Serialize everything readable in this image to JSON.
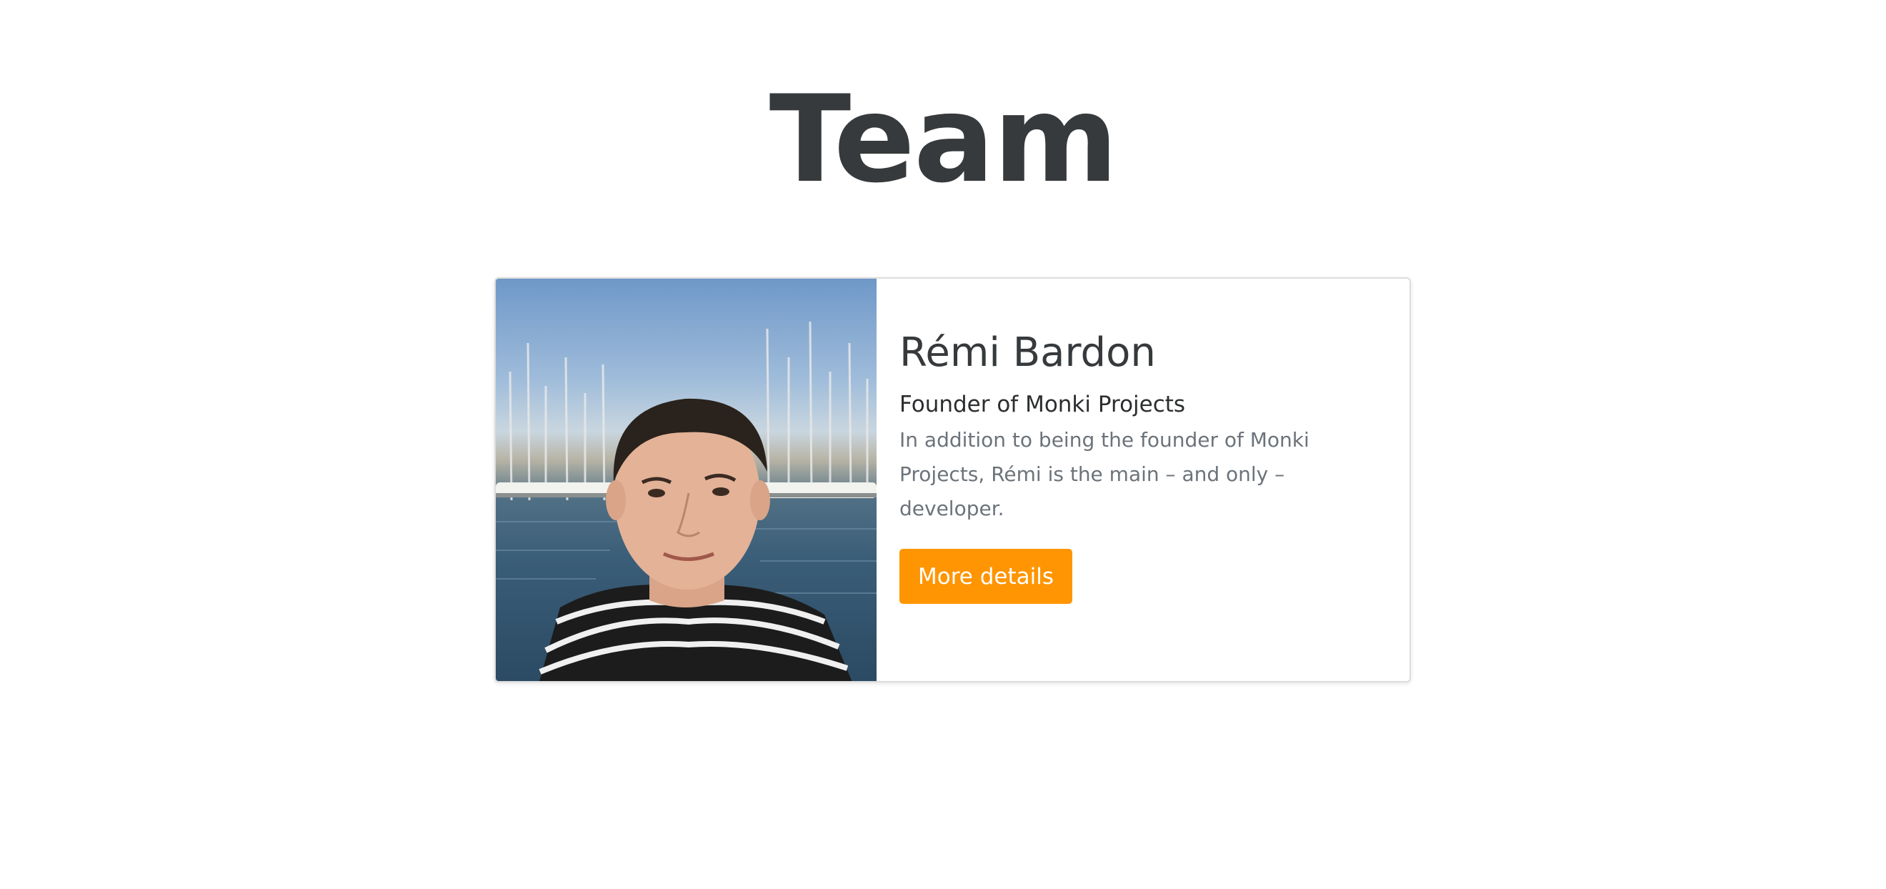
{
  "page": {
    "title": "Team"
  },
  "member": {
    "photo_alt": "Rémi Bardon",
    "name": "Rémi Bardon",
    "role": "Founder of Monki Projects",
    "description": "In addition to being the founder of Monki Projects, Rémi is the main – and only – developer.",
    "button_label": "More details"
  },
  "colors": {
    "title": "#373a3c",
    "accent": "#ff9502",
    "muted_text": "#6c737a",
    "card_border": "#dddddd"
  }
}
